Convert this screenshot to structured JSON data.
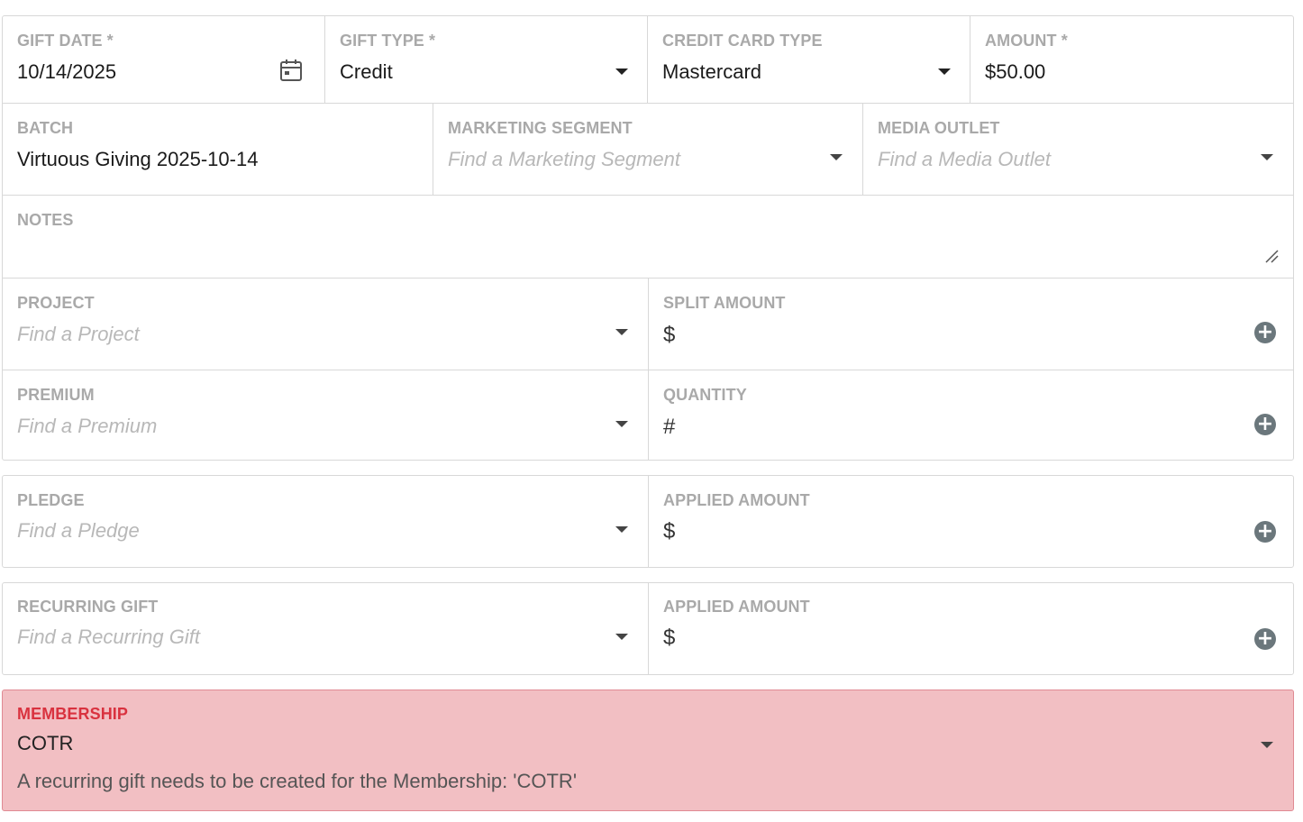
{
  "gift_date": {
    "label": "GIFT DATE *",
    "value": "10/14/2025"
  },
  "gift_type": {
    "label": "GIFT TYPE *",
    "value": "Credit"
  },
  "credit_card_type": {
    "label": "CREDIT CARD TYPE",
    "value": "Mastercard"
  },
  "amount": {
    "label": "AMOUNT *",
    "value": "$50.00"
  },
  "batch": {
    "label": "BATCH",
    "value": "Virtuous Giving 2025-10-14"
  },
  "marketing_segment": {
    "label": "MARKETING SEGMENT",
    "placeholder": "Find a Marketing Segment"
  },
  "media_outlet": {
    "label": "MEDIA OUTLET",
    "placeholder": "Find a Media Outlet"
  },
  "notes": {
    "label": "NOTES",
    "value": ""
  },
  "project": {
    "label": "PROJECT",
    "placeholder": "Find a Project"
  },
  "split_amount": {
    "label": "SPLIT AMOUNT",
    "prefix": "$"
  },
  "premium": {
    "label": "PREMIUM",
    "placeholder": "Find a Premium"
  },
  "quantity": {
    "label": "QUANTITY",
    "prefix": "#"
  },
  "pledge": {
    "label": "PLEDGE",
    "placeholder": "Find a Pledge"
  },
  "pledge_applied_amount": {
    "label": "APPLIED AMOUNT",
    "prefix": "$"
  },
  "recurring_gift": {
    "label": "RECURRING GIFT",
    "placeholder": "Find a Recurring Gift"
  },
  "recurring_applied_amount": {
    "label": "APPLIED AMOUNT",
    "prefix": "$"
  },
  "membership": {
    "label": "MEMBERSHIP",
    "value": "COTR",
    "error": "A recurring gift needs to be created for the Membership: 'COTR'"
  },
  "icons": {
    "calendar": "calendar-icon",
    "dropdown": "chevron-down-icon",
    "add": "plus-circle-icon",
    "resize": "resize-handle-icon"
  },
  "colors": {
    "label": "#a9a9a9",
    "border": "#d8d8d8",
    "error_bg": "#f2bfc3",
    "error_label": "#d9323f",
    "add_icon": "#6b777c"
  }
}
